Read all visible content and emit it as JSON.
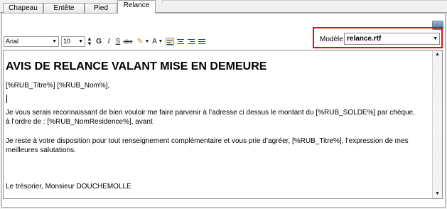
{
  "tabs": [
    "Chapeau",
    "Entête",
    "Pied",
    "Relance"
  ],
  "active_tab": "Relance",
  "toolbar": {
    "font_name": "Arial",
    "font_size": "10",
    "bold_label": "G",
    "italic_label": "I",
    "underline_label": "S",
    "strike_label": "abc",
    "highlight_label": "✎",
    "font_color_label": "A"
  },
  "model": {
    "label": "Modèle :",
    "value": "relance.rtf"
  },
  "document": {
    "heading": "AVIS DE RELANCE VALANT MISE EN DEMEURE",
    "salutation": "[%RUB_Titre%]  [%RUB_Nom%],",
    "para1_line1": "Je vous serais reconnaissant de bien vouloir me faire parvenir à l’adresse ci dessus le montant du [%RUB_SOLDE%] par chèque,",
    "para1_line2": "à l’ordre de : [%RUB_NomResidence%], avant",
    "para2_line1": "Je reste à votre disposition pour tout renseignement complémentaire et vous prie d’agréer, [%RUB_Titre%], l’expression de mes",
    "para2_line2": "meilleures salutations.",
    "signature": "Le trésorier, Monsieur DOUCHEMOLLE"
  },
  "colors": {
    "highlight_frame": "#e01010",
    "align_selected": "#fce6a6"
  }
}
